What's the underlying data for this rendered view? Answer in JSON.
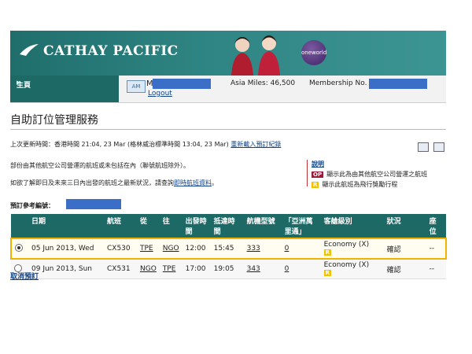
{
  "brand": {
    "name": "CATHAY PACIFIC",
    "alliance": "oneworld"
  },
  "nav": {
    "home_label": "主頁",
    "user_initial": "M",
    "logout_label": "Logout",
    "asia_miles": "Asia Miles: 46,500",
    "membership": "Membership No. :"
  },
  "page": {
    "title": "自助訂位管理服務",
    "updated_text": "上次更新時間：香港時間 21:04, 23 Mar (格林威治標準時間 13:04, 23 Mar)",
    "reload_label": "重新載入預訂紀錄",
    "note1": "部份由其他航空公司營運的航班或未包括在內（聯號航班除外）。",
    "note2_prefix": "如欲了解即日及未來三日內出發的航班之最新狀況，請查詢",
    "note2_link": "即時航班資料",
    "note2_suffix": "。"
  },
  "legend": {
    "title": "說明",
    "op_badge": "OP",
    "op_text": "顯示此為由其他航空公司營運之航班",
    "r_badge": "R",
    "r_text": "顯示此航班為飛行獎勵行程"
  },
  "booking": {
    "ref_label": "預訂參考編號："
  },
  "table": {
    "headers": [
      "日期",
      "航班",
      "從",
      "往",
      "出發時間",
      "抵達時間",
      "航機型號",
      "「亞洲萬里通」",
      "客艙級別",
      "狀況",
      "座位"
    ],
    "rows": [
      {
        "selected": true,
        "date": "05 Jun 2013, Wed",
        "flight": "CX530",
        "from": "TPE",
        "to": "NGO",
        "dep": "12:00",
        "arr": "15:45",
        "aircraft": "333",
        "miles": "0",
        "cabin": "Economy (X)",
        "badge": "R",
        "status": "確認",
        "seat": "--"
      },
      {
        "selected": false,
        "date": "09 Jun 2013, Sun",
        "flight": "CX531",
        "from": "NGO",
        "to": "TPE",
        "dep": "17:00",
        "arr": "19:05",
        "aircraft": "343",
        "miles": "0",
        "cabin": "Economy (X)",
        "badge": "R",
        "status": "確認",
        "seat": "--"
      }
    ]
  },
  "actions": {
    "cancel_label": "取消預訂"
  }
}
